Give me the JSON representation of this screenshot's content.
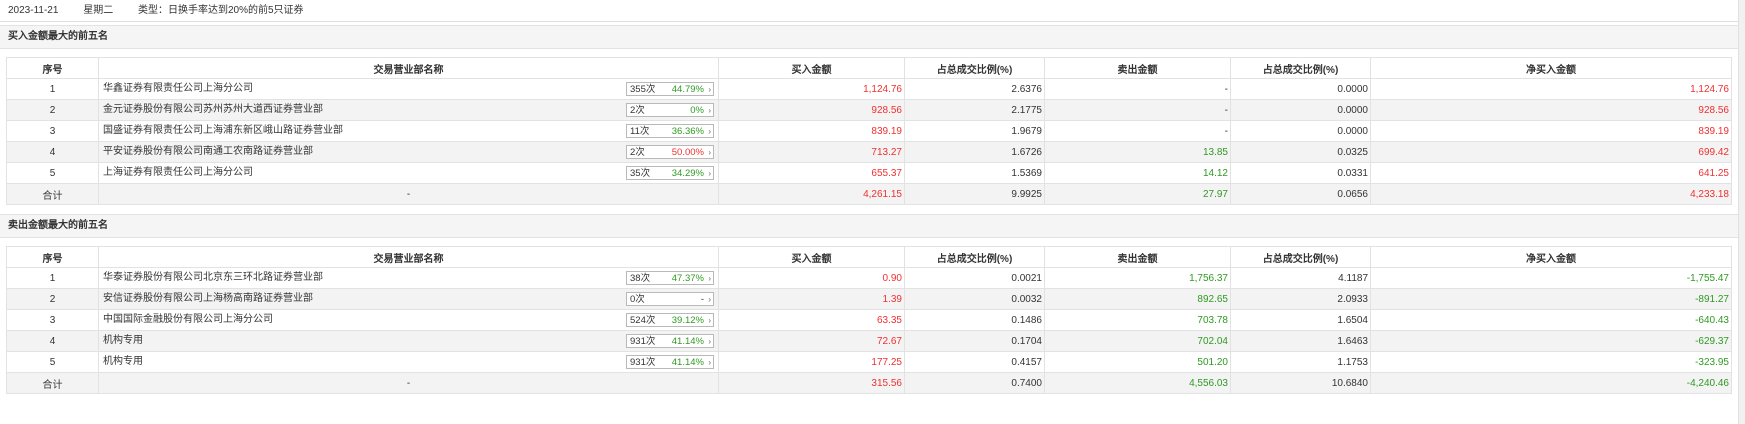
{
  "header": {
    "date": "2023-11-21",
    "weekday": "星期二",
    "type_text": "类型：日换手率达到20%的前5只证券"
  },
  "columns": [
    "序号",
    "交易营业部名称",
    "买入金额",
    "占总成交比例(%)",
    "卖出金额",
    "占总成交比例(%)",
    "净买入金额"
  ],
  "buy_section": {
    "title": "买入金额最大的前五名",
    "rows": [
      {
        "no": "1",
        "name": "华鑫证券有限责任公司上海分公司",
        "count": "355次",
        "pct": "44.79%",
        "pct_color": "green",
        "buy": "1,124.76",
        "buy_pct": "2.6376",
        "sell": "-",
        "sell_pct": "0.0000",
        "net": "1,124.76",
        "net_color": "red"
      },
      {
        "no": "2",
        "name": "金元证券股份有限公司苏州苏州大道西证券营业部",
        "count": "2次",
        "pct": "0%",
        "pct_color": "green",
        "buy": "928.56",
        "buy_pct": "2.1775",
        "sell": "-",
        "sell_pct": "0.0000",
        "net": "928.56",
        "net_color": "red"
      },
      {
        "no": "3",
        "name": "国盛证券有限责任公司上海浦东新区峨山路证券营业部",
        "count": "11次",
        "pct": "36.36%",
        "pct_color": "green",
        "buy": "839.19",
        "buy_pct": "1.9679",
        "sell": "-",
        "sell_pct": "0.0000",
        "net": "839.19",
        "net_color": "red"
      },
      {
        "no": "4",
        "name": "平安证券股份有限公司南通工农南路证券营业部",
        "count": "2次",
        "pct": "50.00%",
        "pct_color": "red",
        "buy": "713.27",
        "buy_pct": "1.6726",
        "sell": "13.85",
        "sell_pct": "0.0325",
        "net": "699.42",
        "net_color": "red"
      },
      {
        "no": "5",
        "name": "上海证券有限责任公司上海分公司",
        "count": "35次",
        "pct": "34.29%",
        "pct_color": "green",
        "buy": "655.37",
        "buy_pct": "1.5369",
        "sell": "14.12",
        "sell_pct": "0.0331",
        "net": "641.25",
        "net_color": "red"
      }
    ],
    "total": {
      "label": "合计",
      "name": "-",
      "buy": "4,261.15",
      "buy_pct": "9.9925",
      "sell": "27.97",
      "sell_pct": "0.0656",
      "net": "4,233.18",
      "net_color": "red"
    }
  },
  "sell_section": {
    "title": "卖出金额最大的前五名",
    "rows": [
      {
        "no": "1",
        "name": "华泰证券股份有限公司北京东三环北路证券营业部",
        "count": "38次",
        "pct": "47.37%",
        "pct_color": "green",
        "buy": "0.90",
        "buy_pct": "0.0021",
        "sell": "1,756.37",
        "sell_pct": "4.1187",
        "net": "-1,755.47",
        "net_color": "green"
      },
      {
        "no": "2",
        "name": "安信证券股份有限公司上海杨高南路证券营业部",
        "count": "0次",
        "pct": "-",
        "pct_color": "dark",
        "buy": "1.39",
        "buy_pct": "0.0032",
        "sell": "892.65",
        "sell_pct": "2.0933",
        "net": "-891.27",
        "net_color": "green"
      },
      {
        "no": "3",
        "name": "中国国际金融股份有限公司上海分公司",
        "count": "524次",
        "pct": "39.12%",
        "pct_color": "green",
        "buy": "63.35",
        "buy_pct": "0.1486",
        "sell": "703.78",
        "sell_pct": "1.6504",
        "net": "-640.43",
        "net_color": "green"
      },
      {
        "no": "4",
        "name": "机构专用",
        "count": "931次",
        "pct": "41.14%",
        "pct_color": "green",
        "buy": "72.67",
        "buy_pct": "0.1704",
        "sell": "702.04",
        "sell_pct": "1.6463",
        "net": "-629.37",
        "net_color": "green"
      },
      {
        "no": "5",
        "name": "机构专用",
        "count": "931次",
        "pct": "41.14%",
        "pct_color": "green",
        "buy": "177.25",
        "buy_pct": "0.4157",
        "sell": "501.20",
        "sell_pct": "1.1753",
        "net": "-323.95",
        "net_color": "green"
      }
    ],
    "total": {
      "label": "合计",
      "name": "-",
      "buy": "315.56",
      "buy_pct": "0.7400",
      "sell": "4,556.03",
      "sell_pct": "10.6840",
      "net": "-4,240.46",
      "net_color": "green"
    }
  },
  "colors": {
    "red": "#f03030",
    "green": "#2f9a22"
  },
  "icons": {
    "row_stat_arrow": "chevron-right-icon"
  }
}
